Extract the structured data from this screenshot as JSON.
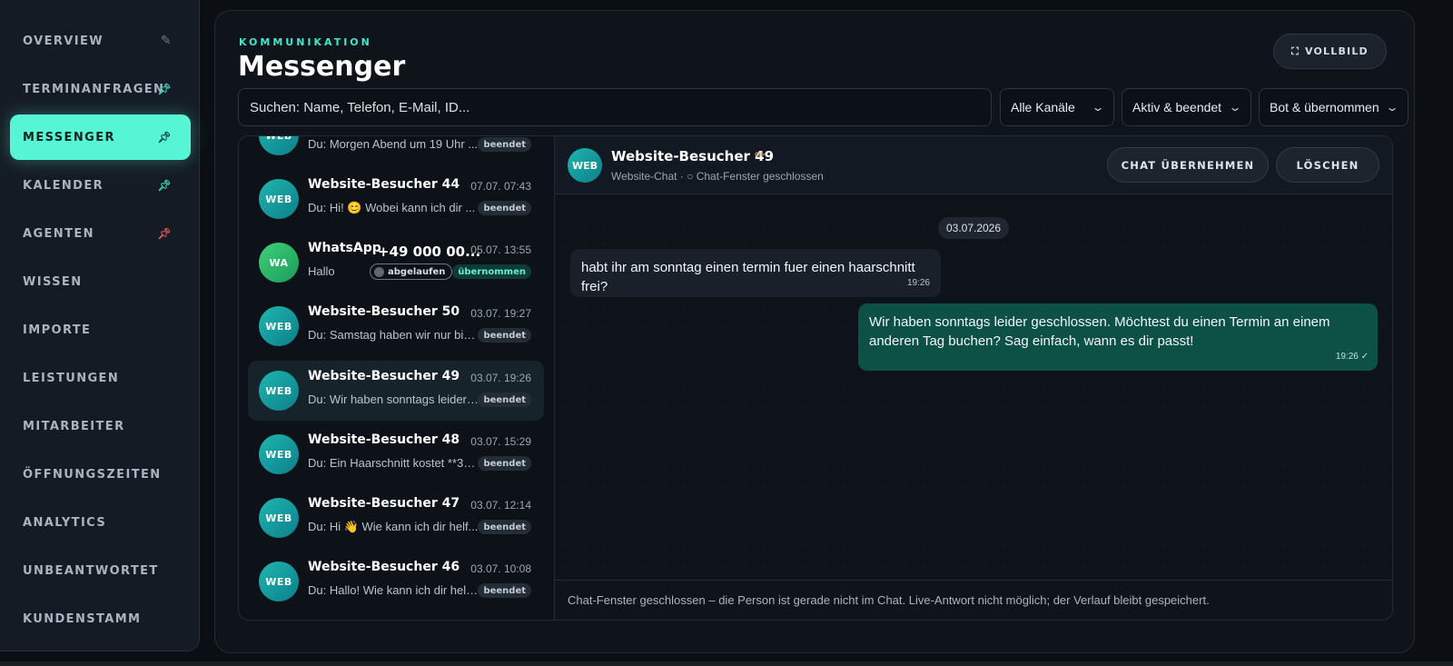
{
  "sidebar": {
    "items": [
      {
        "label": "OVERVIEW",
        "icon": "edit-icon"
      },
      {
        "label": "TERMINANFRAGEN",
        "icon": "pin-icon"
      },
      {
        "label": "MESSENGER",
        "icon": "pin-icon",
        "active": true
      },
      {
        "label": "KALENDER",
        "icon": "pin-icon"
      },
      {
        "label": "AGENTEN",
        "icon": "pin-icon"
      },
      {
        "label": "WISSEN"
      },
      {
        "label": "IMPORTE"
      },
      {
        "label": "LEISTUNGEN"
      },
      {
        "label": "MITARBEITER"
      },
      {
        "label": "ÖFFNUNGSZEITEN"
      },
      {
        "label": "ANALYTICS"
      },
      {
        "label": "UNBEANTWORTET"
      },
      {
        "label": "KUNDENSTAMM"
      }
    ]
  },
  "header": {
    "kicker": "KOMMUNIKATION",
    "title": "Messenger",
    "fullscreen_label": "VOLLBILD"
  },
  "filters": {
    "search_placeholder": "Suchen: Name, Telefon, E-Mail, ID...",
    "channel": "Alle Kanäle",
    "status": "Aktiv & beendet",
    "handler": "Bot & übernommen"
  },
  "chats": [
    {
      "avatar": "WEB",
      "name": "",
      "time": "",
      "preview": "Du: Morgen Abend um 19 Uhr ...",
      "badge": "beendet"
    },
    {
      "avatar": "WEB",
      "name": "Website-Besucher 44",
      "time": "07.07. 07:43",
      "preview": "Du: Hi! 😊 Wobei kann ich dir ...",
      "badge": "beendet"
    },
    {
      "avatar": "WA",
      "name": "WhatsApp",
      "phone": "+49 000 00...",
      "time": "05.07. 13:55",
      "preview": "Hallo",
      "expired": "abgelaufen",
      "badge": "übernommen"
    },
    {
      "avatar": "WEB",
      "name": "Website-Besucher 50",
      "time": "03.07. 19:27",
      "preview": "Du: Samstag haben wir nur bis ...",
      "badge": "beendet"
    },
    {
      "avatar": "WEB",
      "name": "Website-Besucher 49",
      "time": "03.07. 19:26",
      "preview": "Du: Wir haben sonntags leider ...",
      "badge": "beendet",
      "selected": true
    },
    {
      "avatar": "WEB",
      "name": "Website-Besucher 48",
      "time": "03.07. 15:29",
      "preview": "Du: Ein Haarschnitt kostet **35 ...",
      "badge": "beendet"
    },
    {
      "avatar": "WEB",
      "name": "Website-Besucher 47",
      "time": "03.07. 12:14",
      "preview": "Du: Hi 👋 Wie kann ich dir helf...",
      "badge": "beendet"
    },
    {
      "avatar": "WEB",
      "name": "Website-Besucher 46",
      "time": "03.07. 10:08",
      "preview": "Du: Hallo! Wie kann ich dir helf...",
      "badge": "beendet"
    }
  ],
  "conversation": {
    "avatar": "WEB",
    "name": "Website-Besucher 49",
    "subtitle": "Website-Chat · ○ Chat-Fenster geschlossen",
    "take_over_label": "CHAT ÜBERNEHMEN",
    "delete_label": "LÖSCHEN",
    "date": "03.07.2026",
    "messages": [
      {
        "direction": "in",
        "text": "habt ihr am sonntag einen termin fuer einen haarschnitt frei?",
        "time": "19:26"
      },
      {
        "direction": "out",
        "text": "Wir haben sonntags leider geschlossen. Möchtest du einen Termin an einem anderen Tag buchen? Sag einfach, wann es dir passt!",
        "time": "19:26 ✓"
      }
    ],
    "footer": "Chat-Fenster geschlossen – die Person ist gerade nicht im Chat. Live-Antwort nicht möglich; der Verlauf bleibt gespeichert."
  },
  "colors": {
    "accent": "#56f5d6",
    "outgoing_bubble": "#0d5146",
    "panel": "#0f141b"
  }
}
